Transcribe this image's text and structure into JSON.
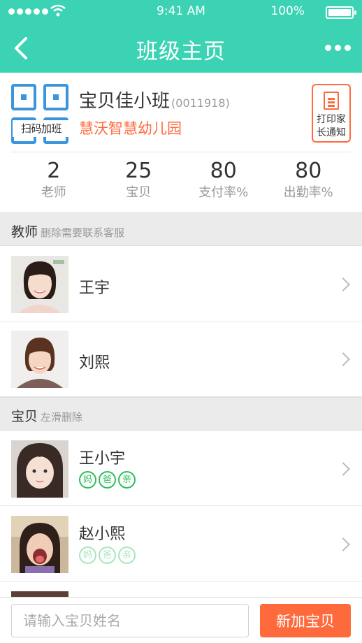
{
  "colors": {
    "primary": "#3bd3b4",
    "accent": "#ff6a3d",
    "qr_blue": "#3a95dc",
    "badge_green": "#2fbf5d"
  },
  "status_bar": {
    "time": "9:41 AM",
    "battery": "100%"
  },
  "nav": {
    "title": "班级主页",
    "back_icon": "chevron-left-icon",
    "more_icon": "more-dots-icon"
  },
  "class_info": {
    "qr_label": "扫码加班",
    "name": "宝贝佳小班",
    "code": "(0011918)",
    "school": "慧沃智慧幼儿园",
    "print_label_1": "打印家",
    "print_label_2": "长通知",
    "stats": [
      {
        "value": "2",
        "label": "老师"
      },
      {
        "value": "25",
        "label": "宝贝"
      },
      {
        "value": "80",
        "label": "支付率%"
      },
      {
        "value": "80",
        "label": "出勤率%"
      }
    ]
  },
  "teachers_section": {
    "title": "教师",
    "note": "删除需要联系客服"
  },
  "teachers": [
    {
      "name": "王宇"
    },
    {
      "name": "刘熙"
    }
  ],
  "babies_section": {
    "title": "宝贝",
    "note": "左滑删除"
  },
  "babies": [
    {
      "name": "王小宇",
      "parents": [
        "妈",
        "爸",
        "亲"
      ],
      "parents_active": true
    },
    {
      "name": "赵小熙",
      "parents": [
        "妈",
        "爸",
        "亲"
      ],
      "parents_active": false
    }
  ],
  "bottom": {
    "search_placeholder": "请输入宝贝姓名",
    "add_button": "新加宝贝"
  }
}
